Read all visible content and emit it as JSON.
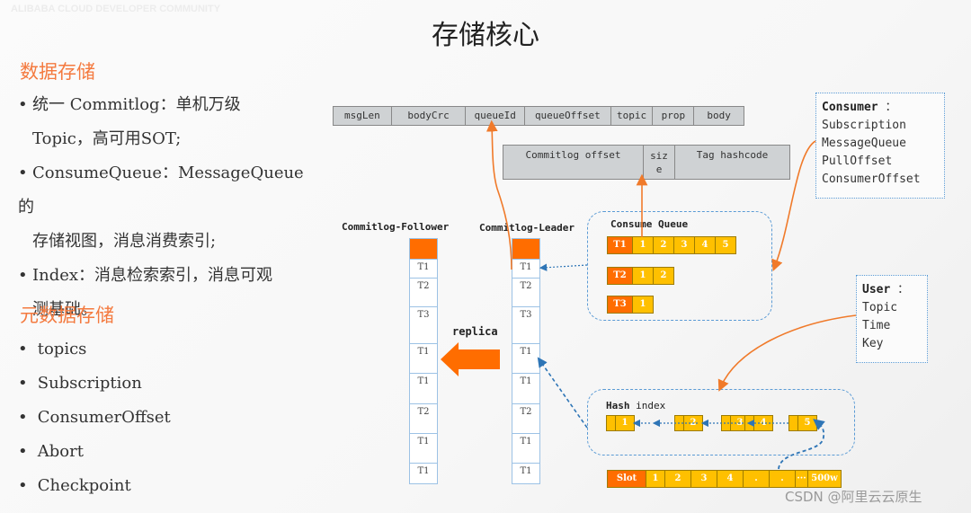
{
  "watermarks": {
    "top_left": "ALIBABA CLOUD DEVELOPER COMMUNITY"
  },
  "title": "存储核心",
  "left_panel": {
    "section1": {
      "heading": "数据存储",
      "bullets": [
        {
          "line1": "统一 Commitlog：单机万级",
          "line2": "Topic，高可用SOT;"
        },
        {
          "line1": "ConsumeQueue：MessageQueue 的",
          "line2": "存储视图，消息消费索引;"
        },
        {
          "line1": "Index：消息检索索引，消息可观",
          "line2": "测基础。"
        }
      ]
    },
    "section2": {
      "heading": "元数据存储",
      "bullets": [
        "topics",
        "Subscription",
        "ConsumerOffset",
        "Abort",
        "Checkpoint"
      ]
    },
    "bullet_glyph": "•"
  },
  "diagram": {
    "message_fields": [
      "msgLen",
      "bodyCrc",
      "queueId",
      "queueOffset",
      "topic",
      "prop",
      "body"
    ],
    "cq_entry_fields": [
      "Commitlog offset",
      "siz\ne",
      "Tag hashcode"
    ],
    "follower_label": "Commitlog-Follower",
    "leader_label": "Commitlog-Leader",
    "commitlog_cells": [
      "T1",
      "T2",
      "T3",
      "T1",
      "T1",
      "T2",
      "T1",
      "T1"
    ],
    "replica_label": "replica",
    "consume_queue": {
      "title": "Consume Queue",
      "rows": [
        {
          "head": "T1",
          "cells": [
            "1",
            "2",
            "3",
            "4",
            "5"
          ]
        },
        {
          "head": "T2",
          "cells": [
            "1",
            "2"
          ]
        },
        {
          "head": "T3",
          "cells": [
            "1"
          ]
        }
      ]
    },
    "consumer_box": {
      "title": "Consumer",
      "colon": "：",
      "items": [
        "Subscription",
        "MessageQueue",
        "PullOffset",
        "ConsumerOffset"
      ]
    },
    "user_box": {
      "title": "User",
      "colon": "：",
      "items": [
        "Topic",
        "Time",
        "Key"
      ]
    },
    "hash_index": {
      "title_bold": "Hash",
      "title_rest": " index",
      "nodes": [
        "1",
        "2",
        "3",
        "4",
        "5"
      ]
    },
    "slot_row": {
      "head": "Slot",
      "cells": [
        "1",
        "2",
        "3",
        "4",
        ".",
        ".",
        "···",
        "500w"
      ]
    }
  },
  "footer": "CSDN @阿里云云原生",
  "colors": {
    "accent_orange": "#ff6d00",
    "cell_yellow": "#ffc000",
    "heading_orange": "#f47a3f",
    "dash_blue": "#5b9bd5",
    "arrow_orange": "#f07a2a",
    "link_blue": "#2e75b6"
  }
}
